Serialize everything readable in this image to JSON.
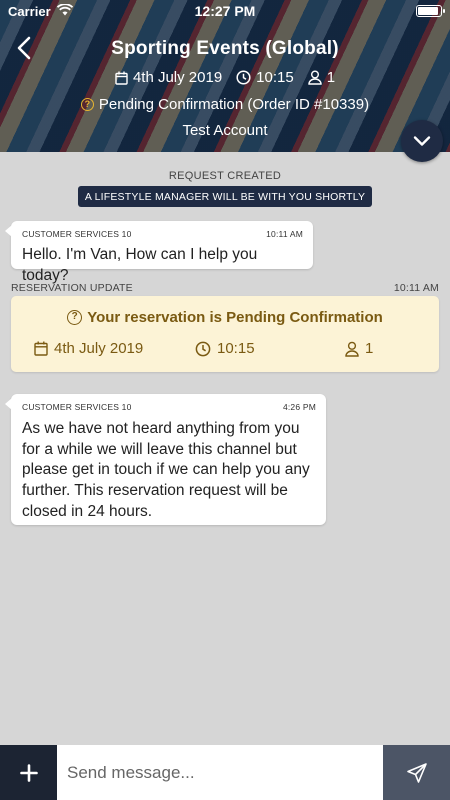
{
  "status_bar": {
    "carrier": "Carrier",
    "time": "12:27 PM"
  },
  "header": {
    "title": "Sporting Events (Global)",
    "date": "4th July 2019",
    "time": "10:15",
    "guests": "1",
    "status": "Pending Confirmation (Order ID #10339)",
    "account": "Test Account"
  },
  "chat": {
    "request_created": "REQUEST CREATED",
    "lifestyle_notice": "A LIFESTYLE MANAGER WILL BE WITH YOU SHORTLY",
    "messages": [
      {
        "sender": "CUSTOMER SERVICES 10",
        "time": "10:11 AM",
        "text": "Hello. I'm Van, How can I help you today?"
      },
      {
        "sender": "CUSTOMER SERVICES 10",
        "time": "4:26 PM",
        "text": "As we have not heard anything from you for a while we will leave this channel but please get in touch if we can help you any further. This reservation request will be closed in 24 hours."
      }
    ],
    "reservation_update": {
      "label": "RESERVATION UPDATE",
      "time": "10:11 AM",
      "title": "Your reservation is Pending Confirmation",
      "date": "4th July 2019",
      "time_slot": "10:15",
      "guests": "1"
    }
  },
  "composer": {
    "placeholder": "Send message..."
  },
  "colors": {
    "navy": "#1f2b44",
    "pending_yellow": "#e8b531",
    "card_bg": "#fcf3d6",
    "card_text": "#7a5a12"
  }
}
